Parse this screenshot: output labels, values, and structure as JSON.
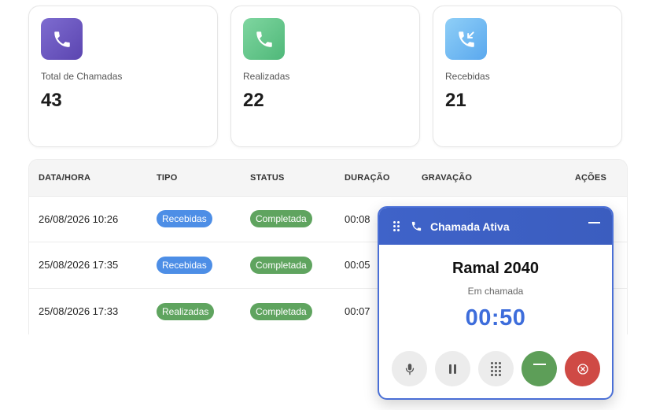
{
  "stats": [
    {
      "label": "Total de Chamadas",
      "value": "43",
      "icon": "phone-icon",
      "color": "#6a55c0"
    },
    {
      "label": "Realizadas",
      "value": "22",
      "icon": "phone-icon",
      "color": "#5cc187"
    },
    {
      "label": "Recebidas",
      "value": "21",
      "icon": "phone-incoming-icon",
      "color": "#6fb6f2"
    }
  ],
  "table": {
    "headers": [
      "DATA/HORA",
      "TIPO",
      "STATUS",
      "DURAÇÃO",
      "GRAVAÇÃO",
      "AÇÕES"
    ],
    "rows": [
      {
        "datetime": "26/08/2026 10:26",
        "type": "Recebidas",
        "status": "Completada",
        "duration": "00:08"
      },
      {
        "datetime": "25/08/2026 17:35",
        "type": "Recebidas",
        "status": "Completada",
        "duration": "00:05"
      },
      {
        "datetime": "25/08/2026 17:33",
        "type": "Realizadas",
        "status": "Completada",
        "duration": "00:07"
      }
    ]
  },
  "call": {
    "title": "Chamada Ativa",
    "extension": "Ramal 2040",
    "status": "Em chamada",
    "timer": "00:50"
  },
  "colors": {
    "accent": "#3d6ddb",
    "badge_blue": "#4d8ee6",
    "badge_green": "#5fa45f",
    "hangup_red": "#cf4a45"
  }
}
